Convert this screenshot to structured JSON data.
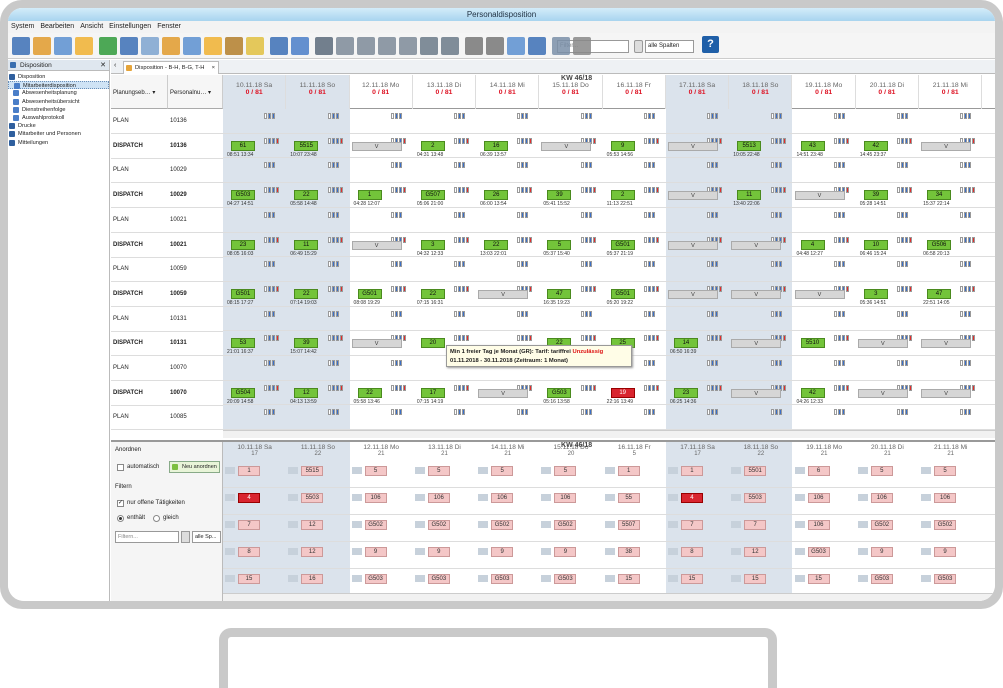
{
  "window_title": "Personaldisposition",
  "menu": [
    "System",
    "Bearbeiten",
    "Ansicht",
    "Einstellungen",
    "Fenster"
  ],
  "toolbar": {
    "search_placeholder": "Filter...",
    "filter_select": "alle Spalten",
    "help_label": "?"
  },
  "sidebar": {
    "title": "Disposition",
    "items": [
      {
        "label": "Disposition",
        "level": 0
      },
      {
        "label": "Mitarbeiterdisposition",
        "level": 1,
        "selected": true
      },
      {
        "label": "Abwesenheitsplanung",
        "level": 1
      },
      {
        "label": "Abwesenheitsübersicht",
        "level": 1
      },
      {
        "label": "Dienstreihenfolge",
        "level": 1
      },
      {
        "label": "Auswahlprotokoll",
        "level": 1
      },
      {
        "label": "Drucke",
        "level": 0
      },
      {
        "label": "Mitarbeiter und Personen",
        "level": 0
      },
      {
        "label": "Mitteilungen",
        "level": 0
      }
    ]
  },
  "tab": {
    "label": "Disposition - B-H, B-G, T-H",
    "close": "×"
  },
  "columns": {
    "planning": "Planungseb…",
    "personnel": "Personalnu…"
  },
  "week_label": "KW 46/18",
  "days": [
    {
      "date": "10.11.18 Sa",
      "count": "0 / 81",
      "weekend": true
    },
    {
      "date": "11.11.18 So",
      "count": "0 / 81",
      "weekend": true
    },
    {
      "date": "12.11.18 Mo",
      "count": "0 / 81",
      "weekend": false
    },
    {
      "date": "13.11.18 Di",
      "count": "0 / 81",
      "weekend": false
    },
    {
      "date": "14.11.18 Mi",
      "count": "0 / 81",
      "weekend": false
    },
    {
      "date": "15.11.18 Do",
      "count": "0 / 81",
      "weekend": false
    },
    {
      "date": "16.11.18 Fr",
      "count": "0 / 81",
      "weekend": false
    },
    {
      "date": "17.11.18 Sa",
      "count": "0 / 81",
      "weekend": true
    },
    {
      "date": "18.11.18 So",
      "count": "0 / 81",
      "weekend": true
    },
    {
      "date": "19.11.18 Mo",
      "count": "0 / 81",
      "weekend": false
    },
    {
      "date": "20.11.18 Di",
      "count": "0 / 81",
      "weekend": false
    },
    {
      "date": "21.11.18 Mi",
      "count": "0 / 81",
      "weekend": false
    }
  ],
  "rows": [
    {
      "level": "PLAN",
      "id": "10136"
    },
    {
      "level": "DISPATCH",
      "id": "10136"
    },
    {
      "level": "PLAN",
      "id": "10029"
    },
    {
      "level": "DISPATCH",
      "id": "10029"
    },
    {
      "level": "PLAN",
      "id": "10021"
    },
    {
      "level": "DISPATCH",
      "id": "10021"
    },
    {
      "level": "PLAN",
      "id": "10059"
    },
    {
      "level": "DISPATCH",
      "id": "10059"
    },
    {
      "level": "PLAN",
      "id": "10131"
    },
    {
      "level": "DISPATCH",
      "id": "10131"
    },
    {
      "level": "PLAN",
      "id": "10070"
    },
    {
      "level": "DISPATCH",
      "id": "10070"
    },
    {
      "level": "PLAN",
      "id": "10085"
    }
  ],
  "dispatch": [
    [
      "61",
      "5515",
      "V",
      "2",
      "16",
      "V",
      "9",
      "V",
      "5513",
      "43",
      "42",
      "V"
    ],
    [
      "G503",
      "22",
      "1",
      "G507",
      "26",
      "39",
      "2",
      "V",
      "11",
      "V",
      "39",
      "34"
    ],
    [
      "23",
      "11",
      "V",
      "3",
      "22",
      "5",
      "G501",
      "V",
      "V",
      "4",
      "10",
      "G506"
    ],
    [
      "G501",
      "22",
      "G501",
      "22",
      "V",
      "47",
      "G501",
      "V",
      "V",
      "V",
      "3",
      "47"
    ],
    [
      "53",
      "39",
      "V",
      "20",
      "",
      "22",
      "25",
      "14",
      "V",
      "5510",
      "V",
      "V"
    ],
    [
      "G504",
      "12",
      "22",
      "17",
      "V",
      "G503",
      "19",
      "23",
      "V",
      "42",
      "V",
      "V"
    ]
  ],
  "dispatch_times": [
    [
      "08:51 13:34",
      "10:07 23:48",
      "",
      "04:31 13:48",
      "06:39 13:57",
      "",
      "05:53 14:56",
      "",
      "10:05 22:48",
      "14:51 23:48",
      "14:45 23:37",
      ""
    ],
    [
      "04:27 14:51",
      "05:58 14:48",
      "04:28 12:07",
      "05:06 21:00",
      "06:00 13:54",
      "05:41 15:52",
      "11:13 22:51",
      "",
      "13:40 22:06",
      "",
      "05:28 14:51",
      "15:37 22:14"
    ],
    [
      "08:05 16:03",
      "06:49 15:29",
      "",
      "04:32 12:33",
      "13:03 22:01",
      "05:37 15:40",
      "05:37 21:19",
      "",
      "",
      "04:48 12:27",
      "06:46 15:24",
      "06:58 20:13"
    ],
    [
      "08:15 17:27",
      "07:14 19:03",
      "08:08 19:29",
      "07:15 16:31",
      "17:53 12:19",
      "16:35 19:23",
      "05:20 19:22",
      "",
      "",
      "",
      "05:36 14:51",
      "22:51 14:05"
    ],
    [
      "21:01 16:37",
      "15:07 14:42",
      "",
      "",
      "",
      "",
      "",
      "06:50 16:39",
      "09:57 21:47",
      "",
      "",
      ""
    ],
    [
      "20:09 14:58",
      "04:13 13:59",
      "05:58 13:46",
      "07:15 14:19",
      "",
      "05:16 13:58",
      "22:16 13:49",
      "06:25 14:36",
      "",
      "04:26 12:33",
      "",
      ""
    ]
  ],
  "tooltip": {
    "line1": "Min 1 freier Tag je Monat (GR): Tarif: tariffrei",
    "status": "Unzulässig",
    "line2": "01.11.2018 - 30.11.2018 (Zeitraum: 1 Monat)"
  },
  "lower": {
    "header_section": "Anordnen",
    "auto_label": "automatisch",
    "new_label": "Neu anordnen",
    "filter_title": "Filtern",
    "open_tasks": "nur offene Tätigkeiten",
    "radio_a": "enthält",
    "radio_b": "gleich",
    "filter_placeholder": "Filtern...",
    "filter_select": "alle Sp...",
    "day_counts": [
      "17",
      "22",
      "21",
      "21",
      "21",
      "20",
      "5",
      "17",
      "22",
      "21",
      "21",
      "21"
    ],
    "tasks": [
      [
        "1",
        "5515",
        "5",
        "5",
        "5",
        "5",
        "1",
        "1",
        "5501",
        "6",
        "5",
        "5"
      ],
      [
        "4",
        "5503",
        "106",
        "106",
        "106",
        "106",
        "55",
        "4",
        "5503",
        "106",
        "106",
        "106"
      ],
      [
        "7",
        "12",
        "G502",
        "G502",
        "G502",
        "G502",
        "5507",
        "7",
        "7",
        "106",
        "G502",
        "G502"
      ],
      [
        "8",
        "12",
        "9",
        "9",
        "9",
        "9",
        "38",
        "8",
        "12",
        "G503",
        "9",
        "9"
      ],
      [
        "15",
        "16",
        "G503",
        "G503",
        "G503",
        "G503",
        "15",
        "15",
        "15",
        "15",
        "G503",
        "G503"
      ]
    ],
    "red_tasks": [
      [
        1,
        0
      ],
      [
        1,
        7
      ]
    ]
  }
}
